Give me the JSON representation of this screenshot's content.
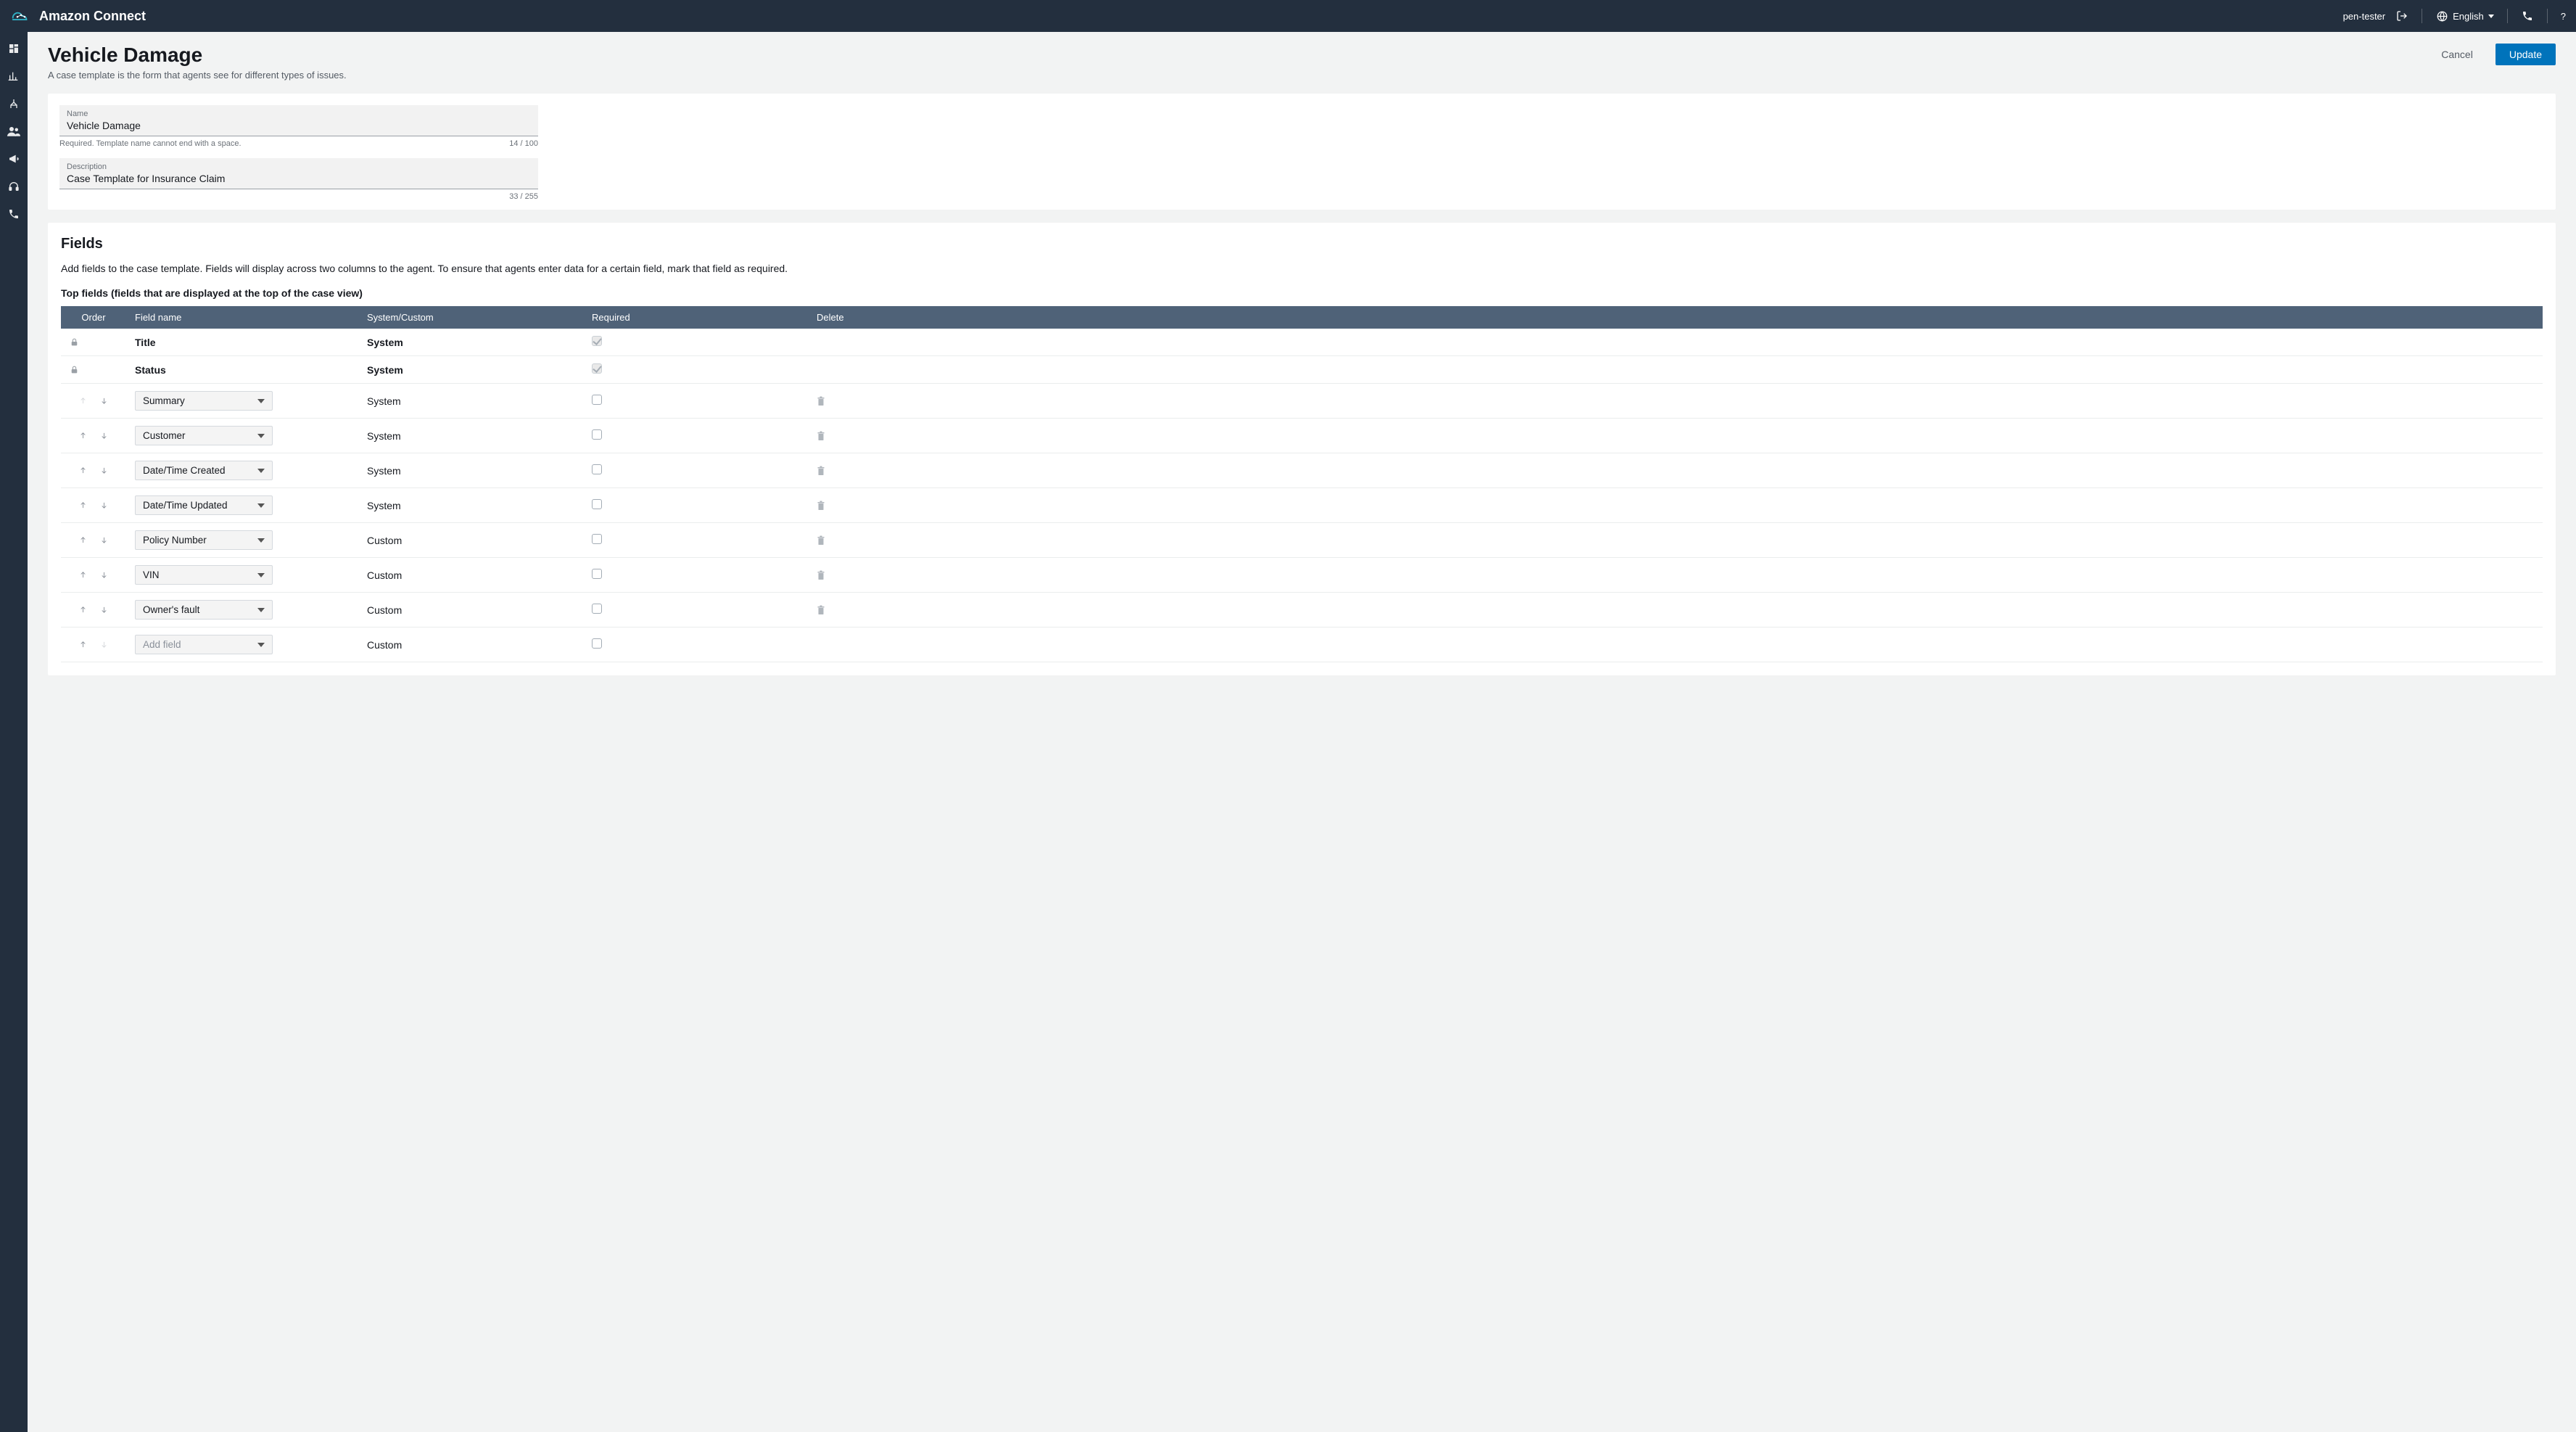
{
  "header": {
    "brand": "Amazon Connect",
    "username": "pen-tester",
    "language": "English",
    "help": "?"
  },
  "page": {
    "title": "Vehicle Damage",
    "subtitle": "A case template is the form that agents see for different types of issues.",
    "cancel": "Cancel",
    "update": "Update"
  },
  "form": {
    "name_label": "Name",
    "name_value": "Vehicle Damage",
    "name_hint": "Required. Template name cannot end with a space.",
    "name_count": "14 / 100",
    "description_label": "Description",
    "description_value": "Case Template for Insurance Claim",
    "description_count": "33 / 255"
  },
  "fields_section": {
    "title": "Fields",
    "description": "Add fields to the case template. Fields will display across two columns to the agent. To ensure that agents enter data for a certain field, mark that field as required.",
    "top_fields_title": "Top fields (fields that are displayed at the top of the case view)",
    "columns": {
      "order": "Order",
      "name": "Field name",
      "system": "System/Custom",
      "required": "Required",
      "delete": "Delete"
    },
    "rows": [
      {
        "kind": "locked",
        "name": "Title",
        "type": "System",
        "required_checked": true
      },
      {
        "kind": "locked",
        "name": "Status",
        "type": "System",
        "required_checked": true
      },
      {
        "kind": "select",
        "up_disabled": true,
        "name": "Summary",
        "type": "System"
      },
      {
        "kind": "select",
        "name": "Customer",
        "type": "System"
      },
      {
        "kind": "select",
        "name": "Date/Time Created",
        "type": "System"
      },
      {
        "kind": "select",
        "name": "Date/Time Updated",
        "type": "System"
      },
      {
        "kind": "select",
        "name": "Policy Number",
        "type": "Custom"
      },
      {
        "kind": "select",
        "name": "VIN",
        "type": "Custom"
      },
      {
        "kind": "select",
        "name": "Owner's fault",
        "type": "Custom"
      },
      {
        "kind": "select",
        "down_disabled": true,
        "placeholder": true,
        "name": "Add field",
        "type": "Custom",
        "no_delete": true
      }
    ]
  }
}
